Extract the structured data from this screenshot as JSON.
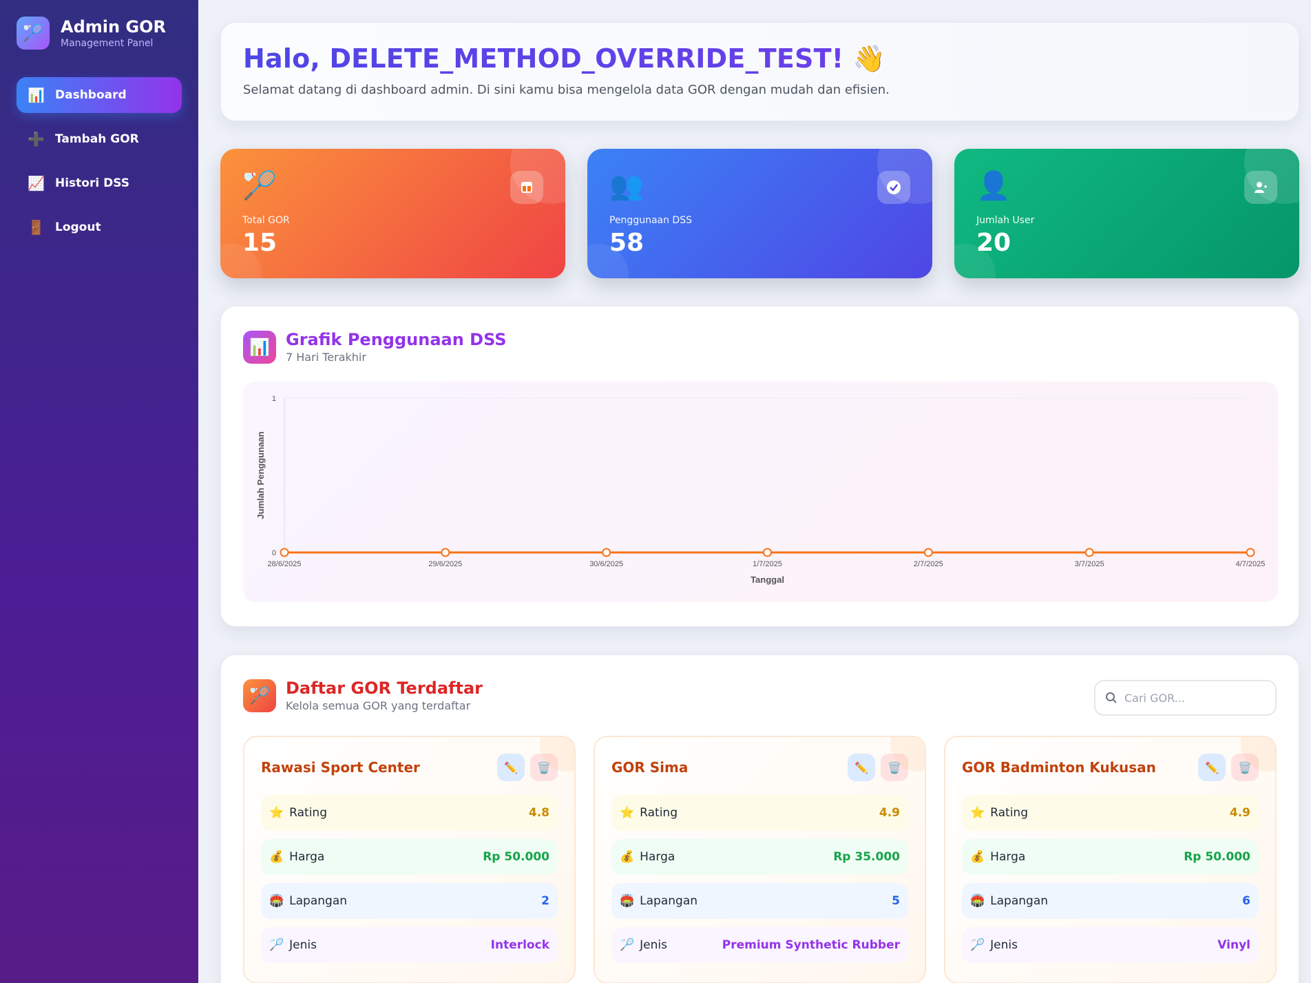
{
  "brand": {
    "title": "Admin GOR",
    "subtitle": "Management Panel",
    "icon": "racket-icon"
  },
  "nav": [
    {
      "label": "Dashboard",
      "icon": "📊",
      "active": true
    },
    {
      "label": "Tambah GOR",
      "icon": "➕",
      "active": false
    },
    {
      "label": "Histori DSS",
      "icon": "📈",
      "active": false
    },
    {
      "label": "Logout",
      "icon": "🚪",
      "active": false
    }
  ],
  "welcome": {
    "title": "Halo, DELETE_METHOD_OVERRIDE_TEST!",
    "wave": "👋",
    "text": "Selamat datang di dashboard admin. Di sini kamu bisa mengelola data GOR dengan mudah dan efisien."
  },
  "stats": [
    {
      "label": "Total GOR",
      "value": "15",
      "emoji": "🏸",
      "color": "#f97316"
    },
    {
      "label": "Penggunaan DSS",
      "value": "58",
      "emoji": "👥",
      "color": "#3b82f6"
    },
    {
      "label": "Jumlah User",
      "value": "20",
      "emoji": "👤",
      "color": "#10b981"
    }
  ],
  "chart_section": {
    "title": "Grafik Penggunaan DSS",
    "subtitle": "7 Hari Terakhir",
    "icon": "📊"
  },
  "chart_data": {
    "type": "line",
    "categories": [
      "28/6/2025",
      "29/6/2025",
      "30/6/2025",
      "1/7/2025",
      "2/7/2025",
      "3/7/2025",
      "4/7/2025"
    ],
    "values": [
      0,
      0,
      0,
      0,
      0,
      0,
      0
    ],
    "xlabel": "Tanggal",
    "ylabel": "Jumlah Penggunaan",
    "ylim": [
      0,
      1
    ],
    "yticks": [
      "0",
      "1"
    ],
    "color": "#f97316",
    "grid": true
  },
  "gor_section": {
    "title": "Daftar GOR Terdaftar",
    "subtitle": "Kelola semua GOR yang terdaftar",
    "icon": "🏸",
    "search_placeholder": "Cari GOR..."
  },
  "gor_labels": {
    "rating": "Rating",
    "harga": "Harga",
    "lapangan": "Lapangan",
    "jenis": "Jenis"
  },
  "gors": [
    {
      "name": "Rawasi Sport Center",
      "rating": "4.8",
      "harga": "Rp 50.000",
      "lapangan": "2",
      "jenis": "Interlock"
    },
    {
      "name": "GOR Sima",
      "rating": "4.9",
      "harga": "Rp 35.000",
      "lapangan": "5",
      "jenis": "Premium Synthetic Rubber"
    },
    {
      "name": "GOR Badminton Kukusan",
      "rating": "4.9",
      "harga": "Rp 50.000",
      "lapangan": "6",
      "jenis": "Vinyl"
    }
  ]
}
